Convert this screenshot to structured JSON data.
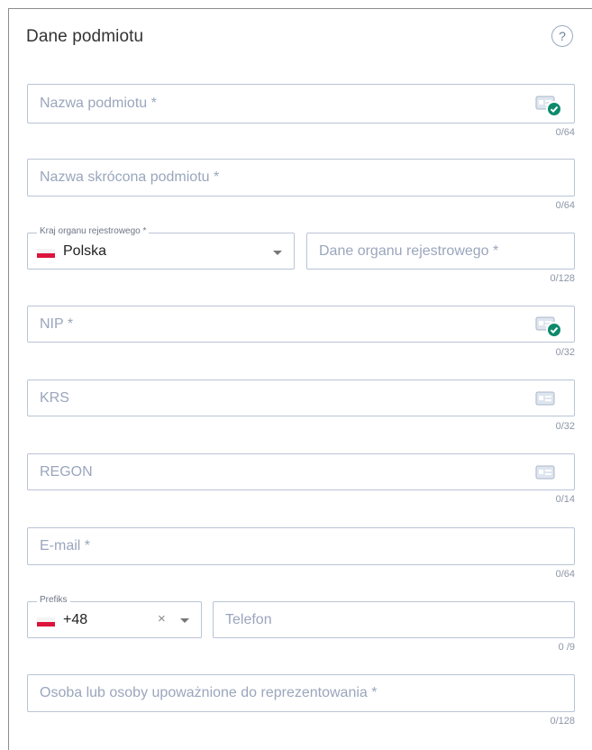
{
  "section": {
    "title": "Dane podmiotu",
    "help": "?"
  },
  "fields": {
    "nazwa": {
      "placeholder": "Nazwa podmiotu *",
      "counter": "0/64"
    },
    "nazwa_skrocona": {
      "placeholder": "Nazwa skrócona podmiotu *",
      "counter": "0/64"
    },
    "kraj": {
      "label": "Kraj organu rejestrowego *",
      "value": "Polska"
    },
    "dane_organu": {
      "placeholder": "Dane organu rejestrowego *",
      "counter": "0/128"
    },
    "nip": {
      "placeholder": "NIP *",
      "counter": "0/32"
    },
    "krs": {
      "placeholder": "KRS",
      "counter": "0/32"
    },
    "regon": {
      "placeholder": "REGON",
      "counter": "0/14"
    },
    "email": {
      "placeholder": "E-mail *",
      "counter": "0/64"
    },
    "prefiks": {
      "label": "Prefiks",
      "value": "+48",
      "clear": "×"
    },
    "telefon": {
      "placeholder": "Telefon",
      "counter": "0 /9"
    },
    "osoba": {
      "placeholder": "Osoba lub osoby upoważnione do reprezentowania *",
      "counter": "0/128"
    }
  },
  "colors": {
    "accent_check": "#0e8a6b",
    "border": "#b9c4d6",
    "placeholder": "#9aa6bc",
    "flag_red": "#dc143c"
  },
  "icons": {
    "id_card": "id-card-icon",
    "check": "check-circle-icon",
    "help": "help-icon",
    "caret": "chevron-down-icon",
    "flag": "poland-flag-icon"
  }
}
